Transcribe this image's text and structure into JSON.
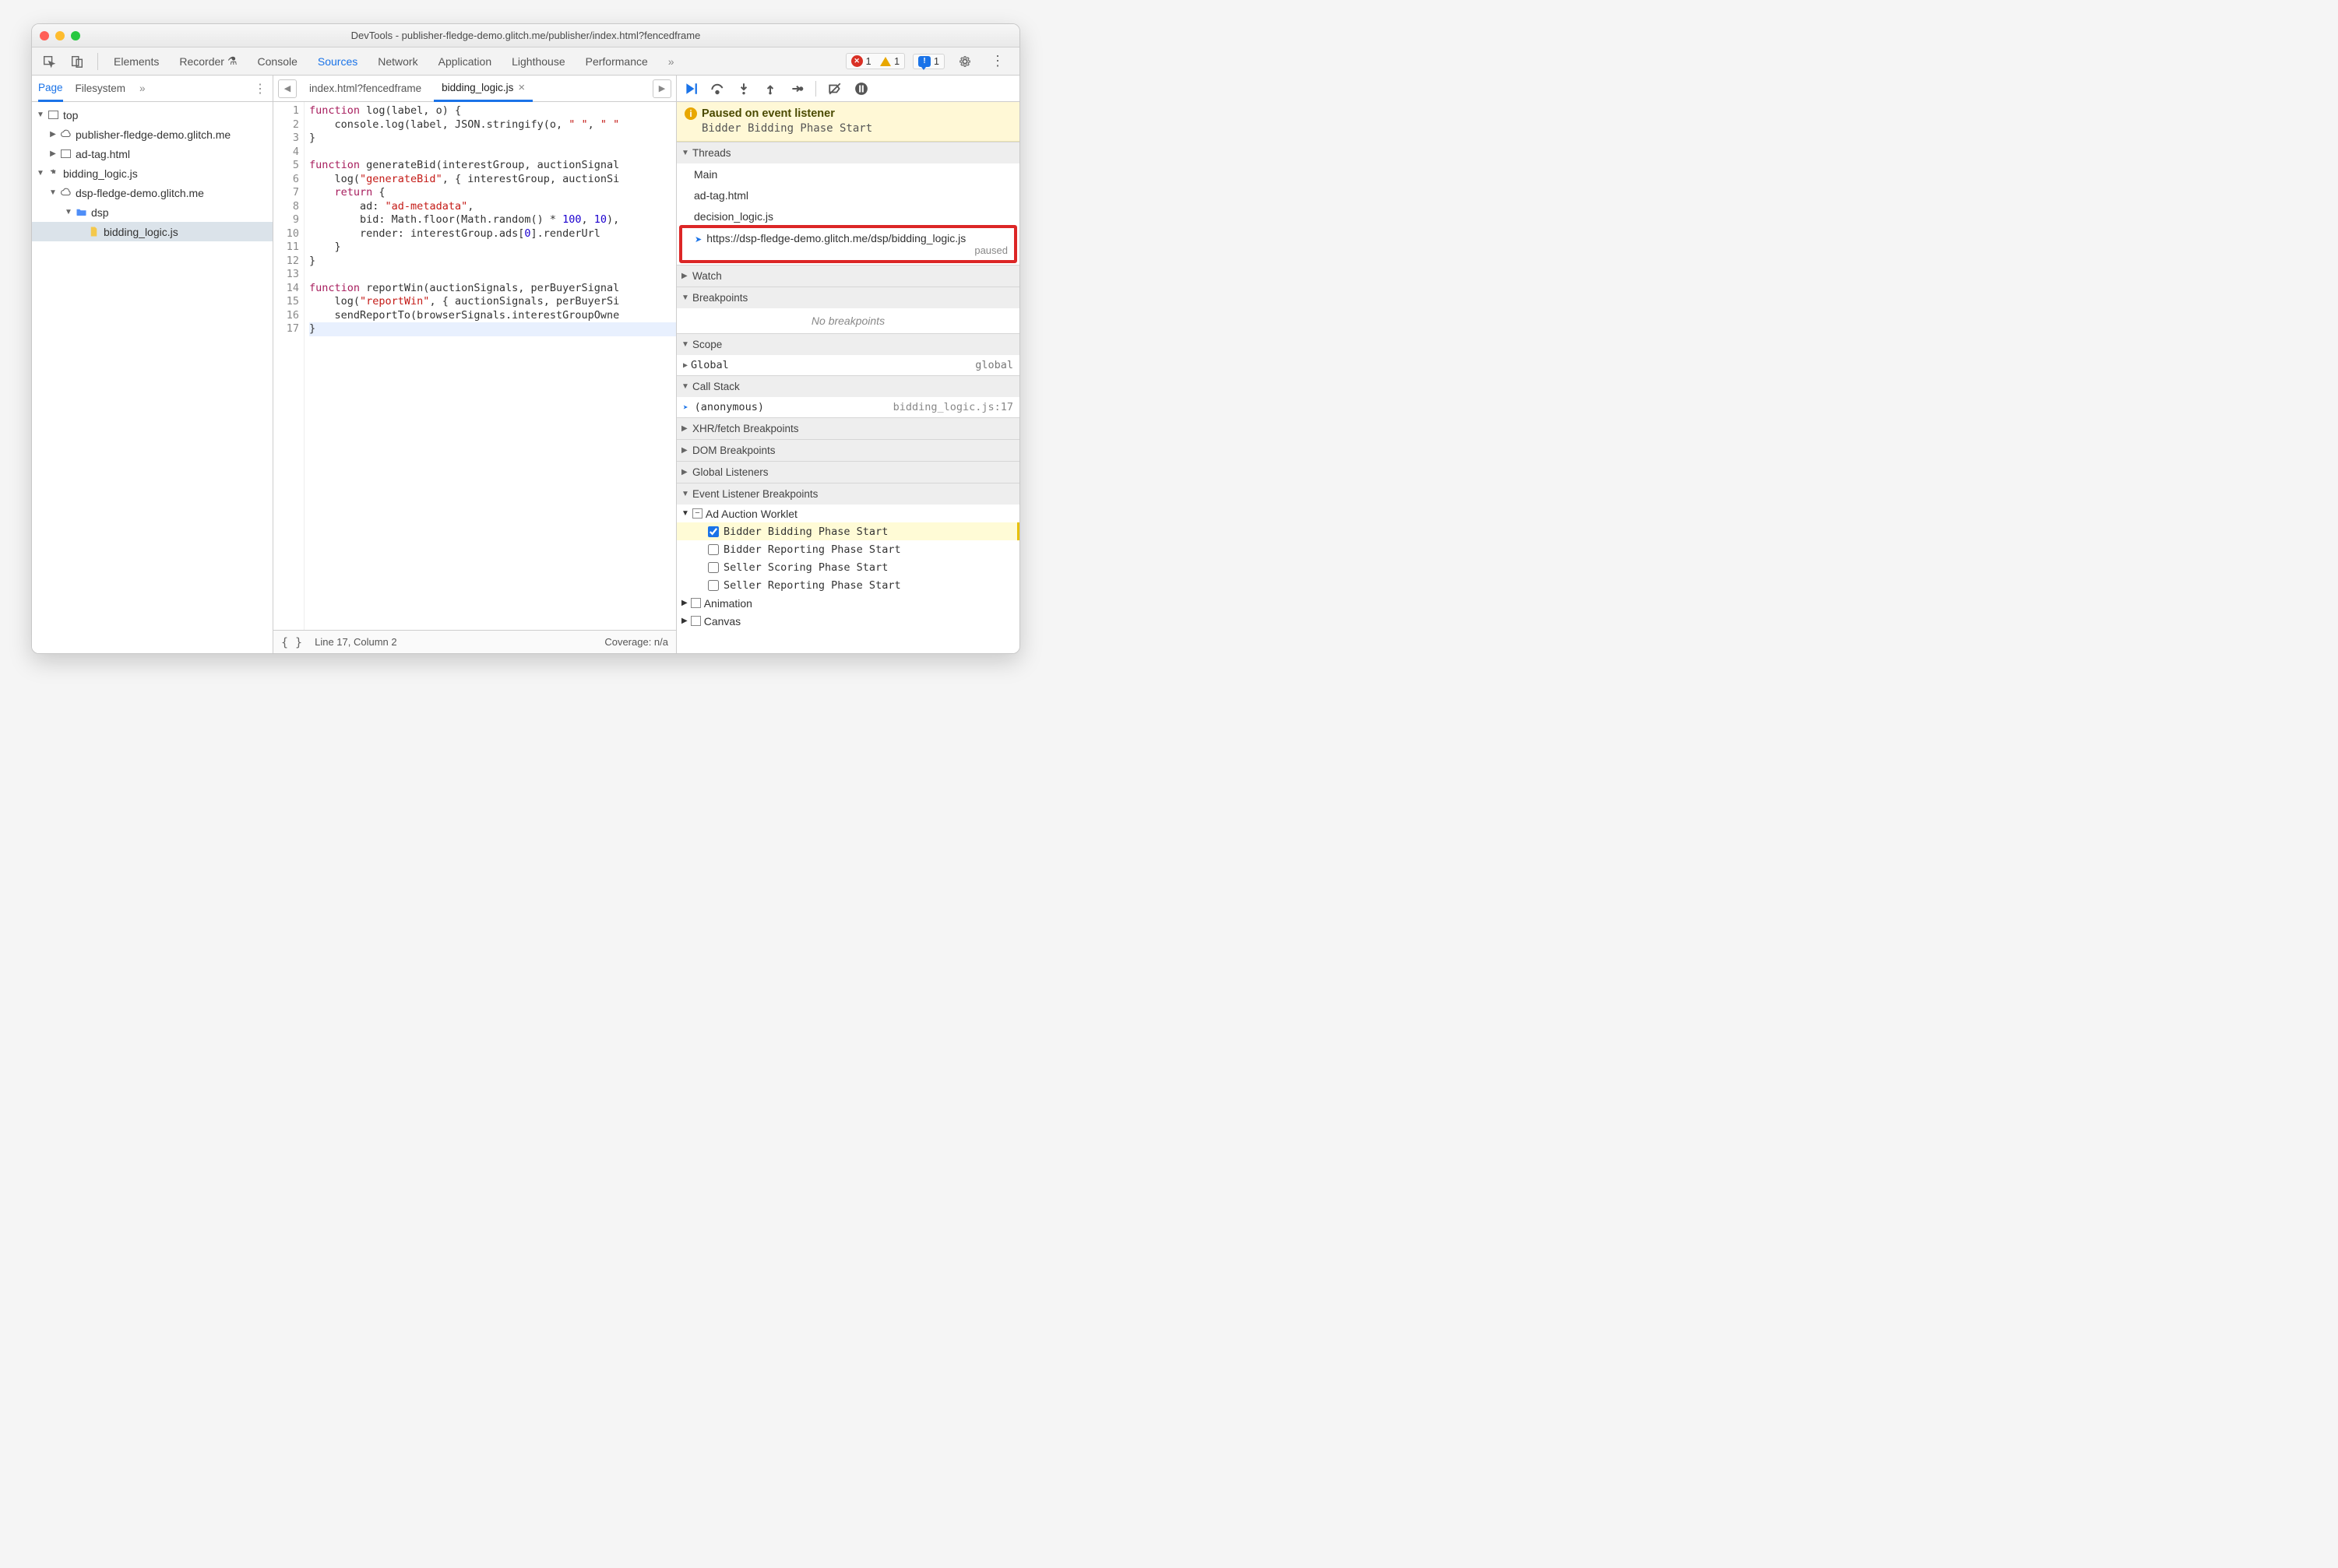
{
  "title": "DevTools - publisher-fledge-demo.glitch.me/publisher/index.html?fencedframe",
  "mainTabs": [
    "Elements",
    "Recorder",
    "Console",
    "Sources",
    "Network",
    "Application",
    "Lighthouse",
    "Performance"
  ],
  "mainTabActive": "Sources",
  "status": {
    "errors": "1",
    "warnings": "1",
    "issues": "1"
  },
  "navTabs": [
    "Page",
    "Filesystem"
  ],
  "navTabActive": "Page",
  "tree": {
    "top": "top",
    "pub": "publisher-fledge-demo.glitch.me",
    "adtag": "ad-tag.html",
    "bidding": "bidding_logic.js",
    "dsp_origin": "dsp-fledge-demo.glitch.me",
    "dsp_folder": "dsp",
    "bidding_file": "bidding_logic.js"
  },
  "editorTabs": {
    "tab1": "index.html?fencedframe",
    "tab2": "bidding_logic.js"
  },
  "code": {
    "l1": "function log(label, o) {",
    "l2": "    console.log(label, JSON.stringify(o, \" \", \" \"",
    "l3": "}",
    "l4": "",
    "l5": "function generateBid(interestGroup, auctionSignal",
    "l6": "    log(\"generateBid\", { interestGroup, auctionSi",
    "l7": "    return {",
    "l8": "        ad: \"ad-metadata\",",
    "l9": "        bid: Math.floor(Math.random() * 100, 10),",
    "l10": "        render: interestGroup.ads[0].renderUrl",
    "l11": "    }",
    "l12": "}",
    "l13": "",
    "l14": "function reportWin(auctionSignals, perBuyerSignal",
    "l15": "    log(\"reportWin\", { auctionSignals, perBuyerSi",
    "l16": "    sendReportTo(browserSignals.interestGroupOwne",
    "l17": "}"
  },
  "lineCount": 17,
  "statusbar": {
    "pos": "Line 17, Column 2",
    "coverage": "Coverage: n/a"
  },
  "paused": {
    "title": "Paused on event listener",
    "detail": "Bidder Bidding Phase Start"
  },
  "sections": {
    "threads": "Threads",
    "watch": "Watch",
    "breakpoints": "Breakpoints",
    "scope": "Scope",
    "callstack": "Call Stack",
    "xhr": "XHR/fetch Breakpoints",
    "dom": "DOM Breakpoints",
    "globals": "Global Listeners",
    "events": "Event Listener Breakpoints"
  },
  "threads": {
    "main": "Main",
    "adtag": "ad-tag.html",
    "decision": "decision_logic.js",
    "current": "https://dsp-fledge-demo.glitch.me/dsp/bidding_logic.js",
    "paused": "paused"
  },
  "noBreakpoints": "No breakpoints",
  "scope": {
    "global": "Global",
    "globalVal": "global"
  },
  "callStack": {
    "frame": "(anonymous)",
    "loc": "bidding_logic.js:17"
  },
  "eventBreakpoints": {
    "group": "Ad Auction Worklet",
    "items": [
      "Bidder Bidding Phase Start",
      "Bidder Reporting Phase Start",
      "Seller Scoring Phase Start",
      "Seller Reporting Phase Start"
    ],
    "animation": "Animation",
    "canvas": "Canvas"
  }
}
